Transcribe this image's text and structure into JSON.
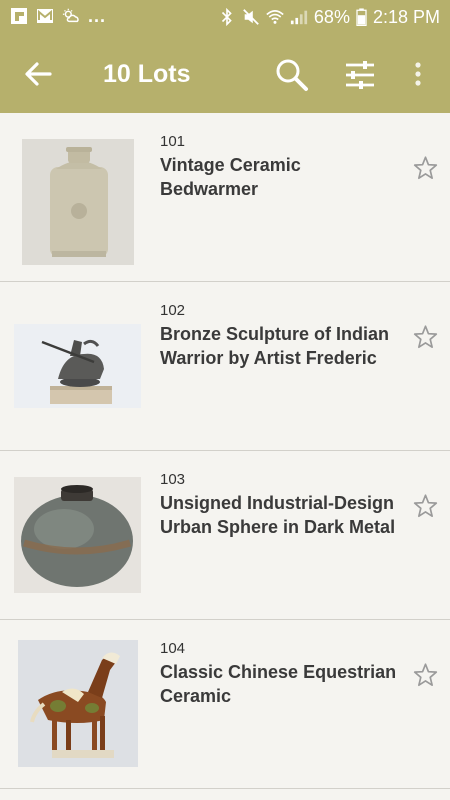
{
  "status_bar": {
    "battery_text": "68%",
    "time": "2:18 PM",
    "more_notifications": "..."
  },
  "app_bar": {
    "title": "10 Lots",
    "icons": [
      "back-arrow-icon",
      "search-icon",
      "filter-icon",
      "more-vert-icon"
    ]
  },
  "lots": [
    {
      "number": "101",
      "title": "Vintage Ceramic Bedwarmer",
      "image": "ceramic-bedwarmer-photo"
    },
    {
      "number": "102",
      "title": "Bronze Sculpture of Indian Warrior by Artist Frederic",
      "image": "bronze-sculpture-photo"
    },
    {
      "number": "103",
      "title": "Unsigned Industrial-Design Urban Sphere in Dark Metal",
      "image": "metal-sphere-photo"
    },
    {
      "number": "104",
      "title": "Classic Chinese Equestrian Ceramic",
      "image": "ceramic-horse-photo"
    }
  ],
  "colors": {
    "toolbar": "#b6b06c",
    "background": "#f5f4f0",
    "divider": "#d2d0ca"
  }
}
